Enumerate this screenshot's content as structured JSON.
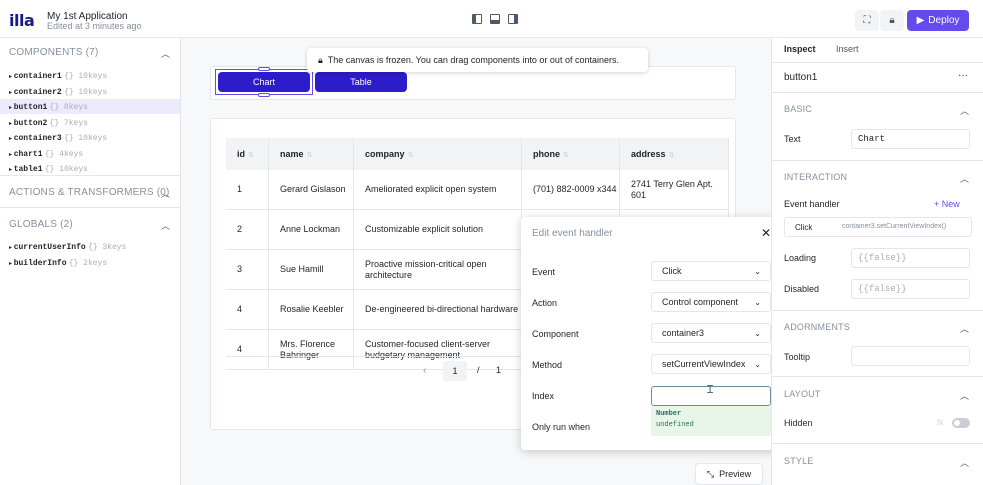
{
  "topbar": {
    "logo": "illa",
    "app_title": "My 1st Application",
    "edited": "Edited at 3 minutes ago",
    "deploy_label": "Deploy",
    "accent": "#654aec"
  },
  "left": {
    "components_header": "COMPONENTS (7)",
    "components": [
      {
        "name": "container1",
        "meta": "{} 10keys"
      },
      {
        "name": "container2",
        "meta": "{} 10keys"
      },
      {
        "name": "button1",
        "meta": "{} 8keys"
      },
      {
        "name": "button2",
        "meta": "{} 7keys"
      },
      {
        "name": "container3",
        "meta": "{} 10keys"
      },
      {
        "name": "chart1",
        "meta": "{} 4keys"
      },
      {
        "name": "table1",
        "meta": "{} 10keys"
      }
    ],
    "actions_header": "ACTIONS & TRANSFORMERS (0)",
    "globals_header": "GLOBALS (2)",
    "globals": [
      {
        "name": "currentUserInfo",
        "meta": "{} 3keys"
      },
      {
        "name": "builderInfo",
        "meta": "{} 2keys"
      }
    ]
  },
  "canvas": {
    "frozen_msg": "The canvas is frozen. You can drag components into or out of containers.",
    "chart_btn": "Chart",
    "table_btn": "Table",
    "columns": [
      "id",
      "name",
      "company",
      "phone",
      "address"
    ],
    "rows": [
      [
        "1",
        "Gerard Gislason",
        "Ameliorated explicit open system",
        "(701) 882-0009 x344",
        "2741 Terry Glen Apt. 601"
      ],
      [
        "2",
        "Anne Lockman",
        "Customizable explicit solution",
        "",
        ""
      ],
      [
        "3",
        "Sue Hamill",
        "Proactive mission-critical open architecture",
        "",
        ""
      ],
      [
        "4",
        "Rosalie Keebler",
        "De-engineered bi-directional hardware",
        "",
        ""
      ],
      [
        "4",
        "Mrs. Florence Bahringer",
        "Customer-focused client-server budgetary management",
        "",
        ""
      ]
    ],
    "pager": {
      "prev": "‹",
      "current": "1",
      "sep": "/",
      "total": "1"
    },
    "preview": "Preview"
  },
  "popup": {
    "title": "Edit event handler",
    "close": "✕",
    "fields": [
      {
        "label": "Event",
        "value": "Click"
      },
      {
        "label": "Action",
        "value": "Control component"
      },
      {
        "label": "Component",
        "value": "container3"
      },
      {
        "label": "Method",
        "value": "setCurrentViewIndex"
      }
    ],
    "index_label": "Index",
    "index_value": "",
    "hint_type": "Number",
    "hint_value": "undefined",
    "only_run_label": "Only run when"
  },
  "right": {
    "tab_inspect": "Inspect",
    "tab_insert": "Insert",
    "component": "button1",
    "more": "···",
    "basic": "BASIC",
    "text_label": "Text",
    "text_value": "Chart",
    "interaction": "INTERACTION",
    "event_handler": "Event handler",
    "new": "+ New",
    "handler_event": "Click",
    "handler_action": "container3.setCurrentViewIndex()",
    "loading_label": "Loading",
    "loading_value": "{{false}}",
    "disabled_label": "Disabled",
    "disabled_value": "{{false}}",
    "adornments": "ADORNMENTS",
    "tooltip_label": "Tooltip",
    "tooltip_value": "",
    "layout": "LAYOUT",
    "hidden_label": "Hidden",
    "fx": "fx",
    "style": "STYLE"
  }
}
